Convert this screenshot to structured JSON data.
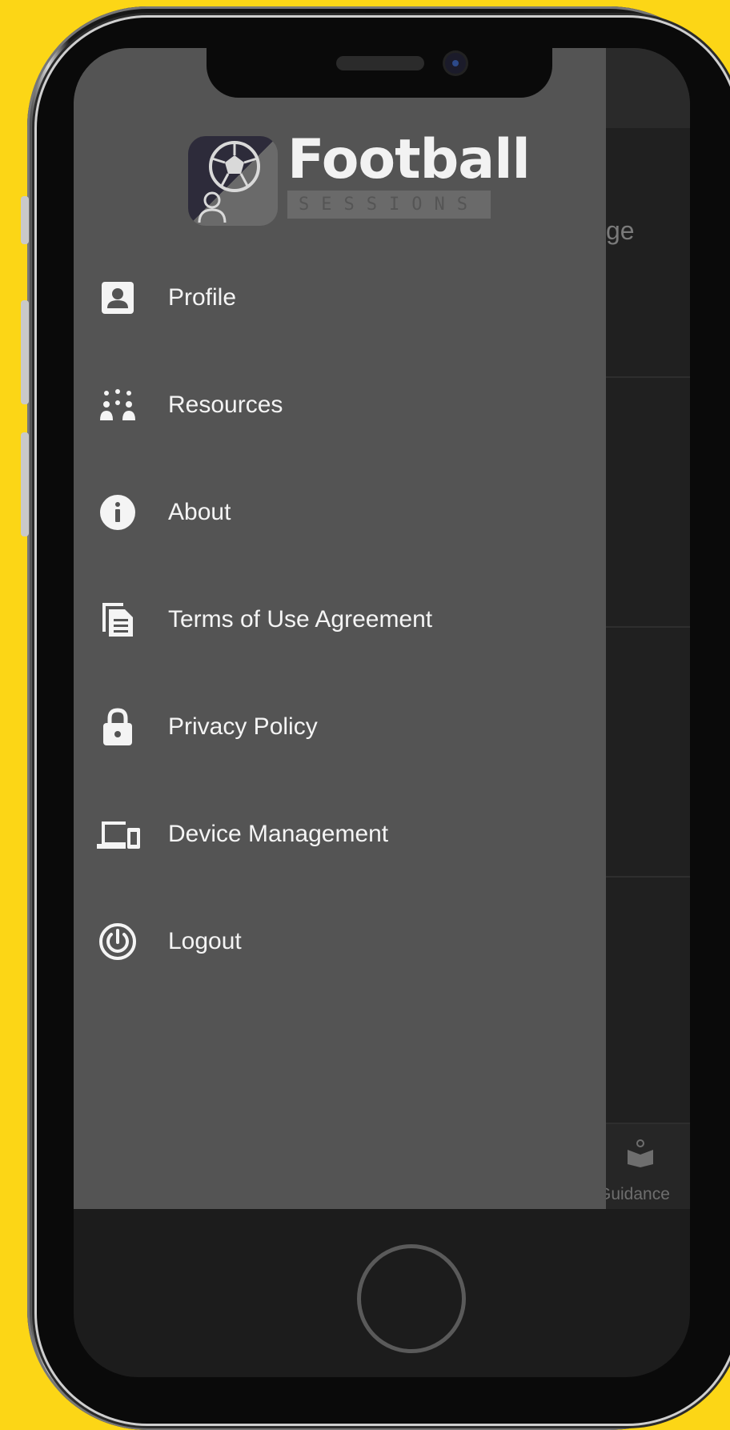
{
  "background_color": "#fcd616",
  "app": {
    "logo": {
      "word": "Football",
      "sub": "SESSIONS"
    },
    "menu": [
      {
        "label": "Profile",
        "icon": "profile-badge-icon"
      },
      {
        "label": "Resources",
        "icon": "resources-icon"
      },
      {
        "label": "About",
        "icon": "info-icon"
      },
      {
        "label": "Terms of Use Agreement",
        "icon": "document-copy-icon"
      },
      {
        "label": "Privacy Policy",
        "icon": "lock-icon"
      },
      {
        "label": "Device Management",
        "icon": "devices-icon"
      },
      {
        "label": "Logout",
        "icon": "power-icon"
      }
    ],
    "background_screen": {
      "partial_text": "ge",
      "tab_label": "Guidance"
    }
  }
}
